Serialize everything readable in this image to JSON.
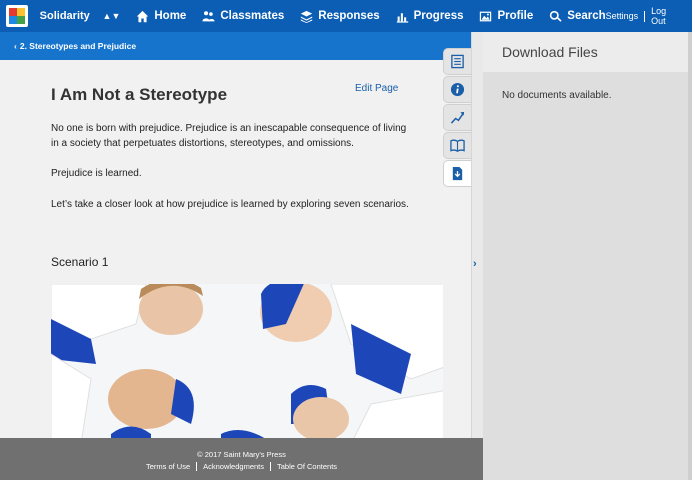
{
  "nav": {
    "course": "Solidarity",
    "items": [
      {
        "label": "Home",
        "icon": "home-icon"
      },
      {
        "label": "Classmates",
        "icon": "people-icon"
      },
      {
        "label": "Responses",
        "icon": "layers-icon"
      },
      {
        "label": "Progress",
        "icon": "bar-chart-icon"
      },
      {
        "label": "Profile",
        "icon": "image-icon"
      },
      {
        "label": "Search",
        "icon": "search-icon"
      }
    ],
    "settings": "Settings",
    "logout": "Log Out"
  },
  "breadcrumb": "2. Stereotypes and Prejudice",
  "page": {
    "title": "I Am Not a Stereotype",
    "edit": "Edit Page",
    "paragraphs": [
      "No one is born with prejudice. Prejudice is an inescapable consequence of living in a society that perpetuates distortions, stereotypes, and omissions.",
      "Prejudice is learned.",
      "Let’s take a closer look at how prejudice is learned by exploring seven scenarios."
    ],
    "scenario": "Scenario 1"
  },
  "panel": {
    "title": "Download Files",
    "message": "No documents available."
  },
  "footer": {
    "copyright": "© 2017 Saint Mary's Press",
    "links": [
      "Terms of Use",
      "Acknowledgments",
      "Table Of Contents"
    ]
  },
  "colors": {
    "nav": "#0b5eb3",
    "breadcrumb": "#1774cc",
    "accent": "#1a5fa8"
  }
}
